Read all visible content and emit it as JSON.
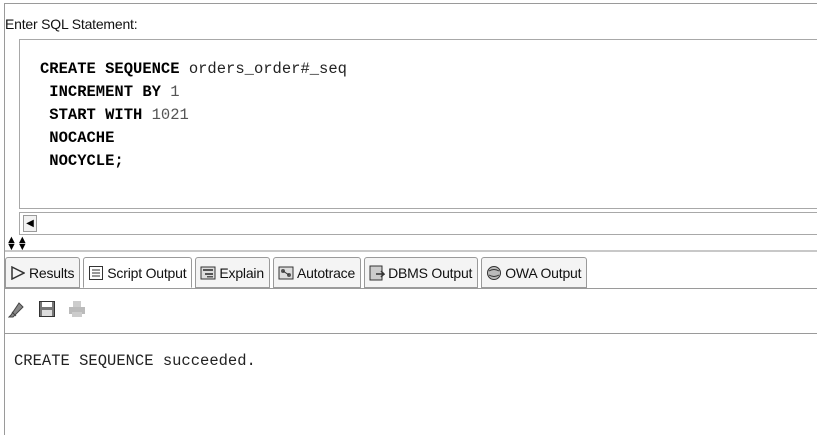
{
  "editor": {
    "label": "Enter SQL Statement:",
    "code_lines": [
      {
        "parts": [
          {
            "text": "CREATE SEQUENCE",
            "kind": "kw"
          },
          {
            "text": " orders_order#_seq",
            "kind": "id"
          }
        ]
      },
      {
        "parts": [
          {
            "text": " INCREMENT BY",
            "kind": "kw"
          },
          {
            "text": " 1",
            "kind": "num"
          }
        ]
      },
      {
        "parts": [
          {
            "text": " START WITH",
            "kind": "kw"
          },
          {
            "text": " 1021",
            "kind": "num"
          }
        ]
      },
      {
        "parts": [
          {
            "text": " NOCACHE",
            "kind": "kw"
          }
        ]
      },
      {
        "parts": [
          {
            "text": " NOCYCLE;",
            "kind": "kw"
          }
        ]
      }
    ]
  },
  "tabs": [
    {
      "label": "Results",
      "icon": "results-icon",
      "active": false
    },
    {
      "label": "Script Output",
      "icon": "script-output-icon",
      "active": true
    },
    {
      "label": "Explain",
      "icon": "explain-icon",
      "active": false
    },
    {
      "label": "Autotrace",
      "icon": "autotrace-icon",
      "active": false
    },
    {
      "label": "DBMS Output",
      "icon": "dbms-output-icon",
      "active": false
    },
    {
      "label": "OWA Output",
      "icon": "owa-output-icon",
      "active": false
    }
  ],
  "toolbar": {
    "buttons": [
      {
        "icon": "eraser-icon",
        "enabled": true
      },
      {
        "icon": "save-icon",
        "enabled": true
      },
      {
        "icon": "print-icon",
        "enabled": false
      }
    ]
  },
  "output": {
    "text": "CREATE SEQUENCE succeeded."
  }
}
